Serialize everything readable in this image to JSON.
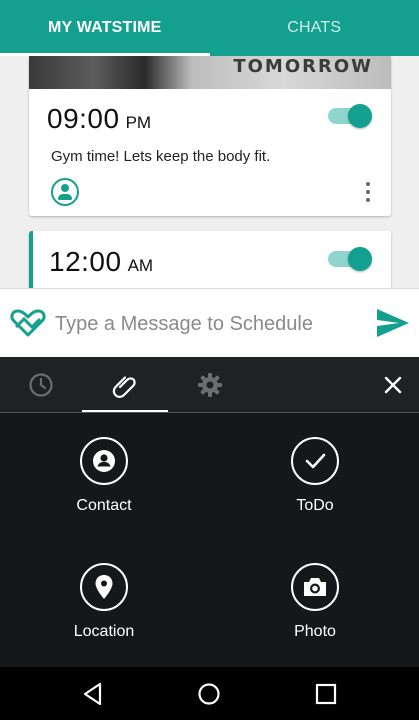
{
  "tabs": [
    {
      "label": "MY WATSTIME",
      "active": true
    },
    {
      "label": "CHATS",
      "active": false
    }
  ],
  "feed": {
    "card1": {
      "image_text": "TOMORROW",
      "time": "09:00",
      "ampm": "PM",
      "message": "Gym time! Lets keep the body fit.",
      "enabled": true
    },
    "card2": {
      "time": "12:00",
      "ampm": "AM",
      "enabled": true
    }
  },
  "compose": {
    "placeholder": "Type a Message to Schedule"
  },
  "panel": {
    "tabs": [
      "clock-icon",
      "paperclip-icon",
      "gear-icon",
      "close-icon"
    ],
    "active_tab": "paperclip-icon",
    "items": [
      {
        "label": "Contact",
        "icon": "person-icon"
      },
      {
        "label": "ToDo",
        "icon": "checkmark-icon"
      },
      {
        "label": "Location",
        "icon": "map-pin-icon"
      },
      {
        "label": "Photo",
        "icon": "camera-icon"
      }
    ]
  },
  "colors": {
    "accent": "#14a08f",
    "panel_bg": "#202125",
    "grid_bg": "#16171a"
  }
}
